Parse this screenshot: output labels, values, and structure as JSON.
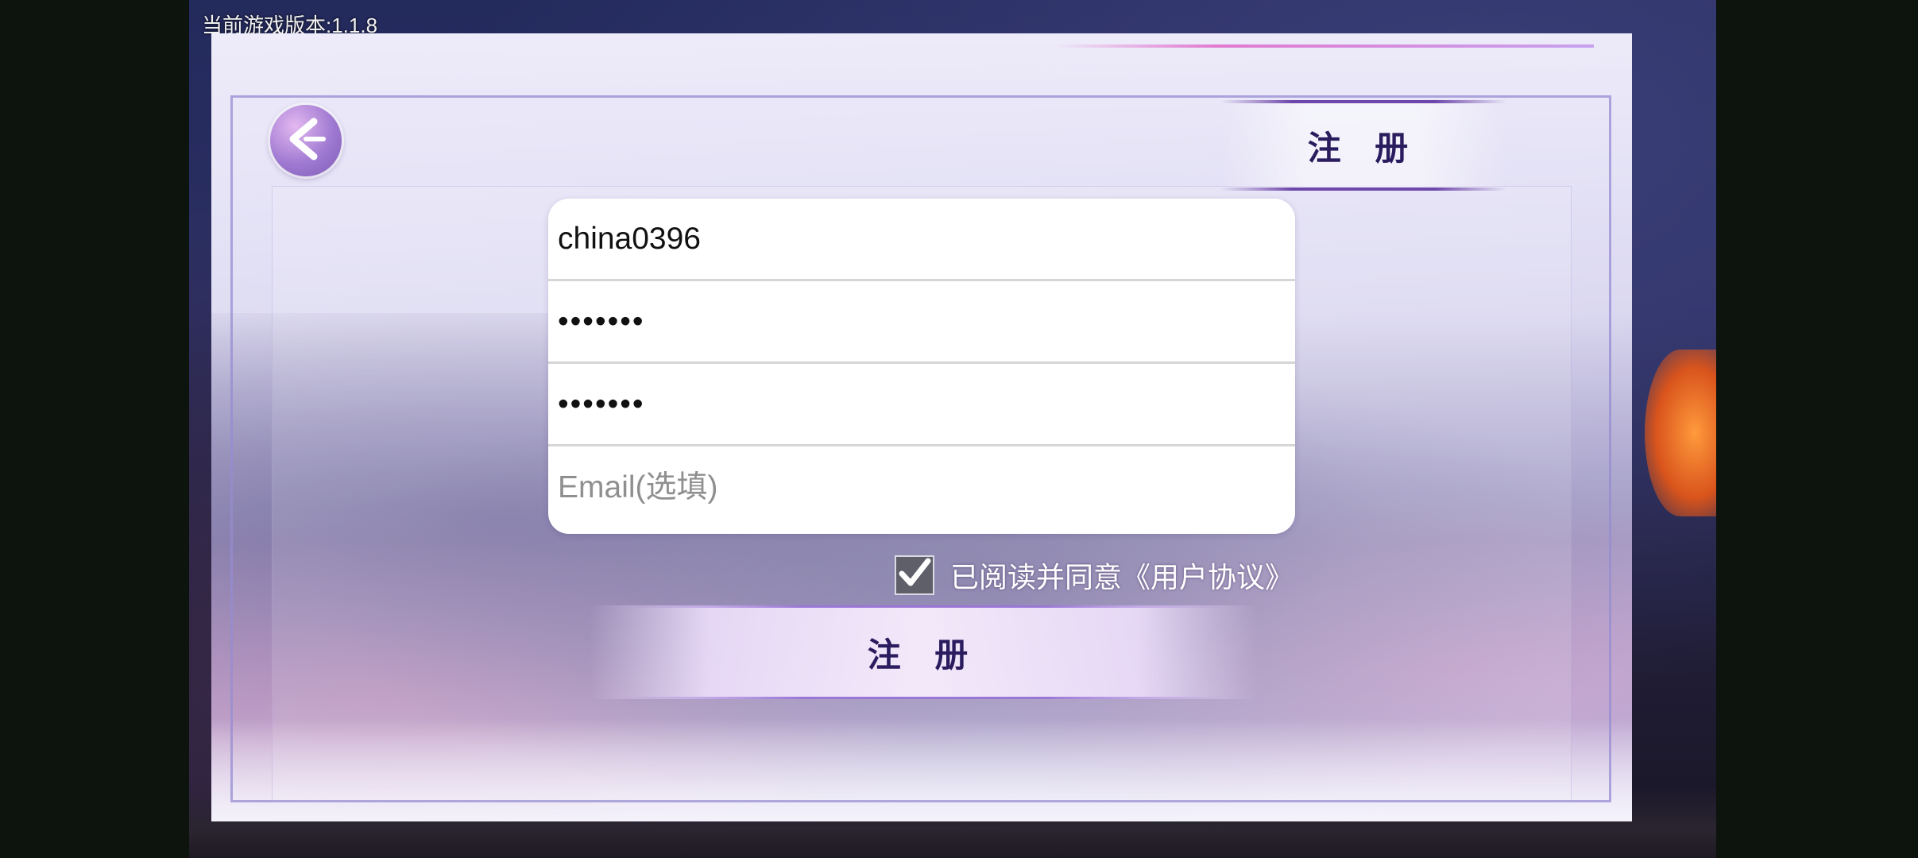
{
  "app": {
    "version_label": "当前游戏版本:1.1.8"
  },
  "header": {
    "title": "注 册",
    "back_icon": "chevron-left-icon"
  },
  "form": {
    "username_value": "china0396",
    "password_value": "1234567",
    "confirm_password_value": "1234567",
    "email_value": "",
    "email_placeholder": "Email(选填)"
  },
  "agreement": {
    "checked": true,
    "label": "已阅读并同意《用户协议》"
  },
  "actions": {
    "register_label": "注 册"
  },
  "colors": {
    "title_text": "#2a1c5e",
    "accent_purple": "#6e47aa",
    "card_background": "#ffffff"
  }
}
